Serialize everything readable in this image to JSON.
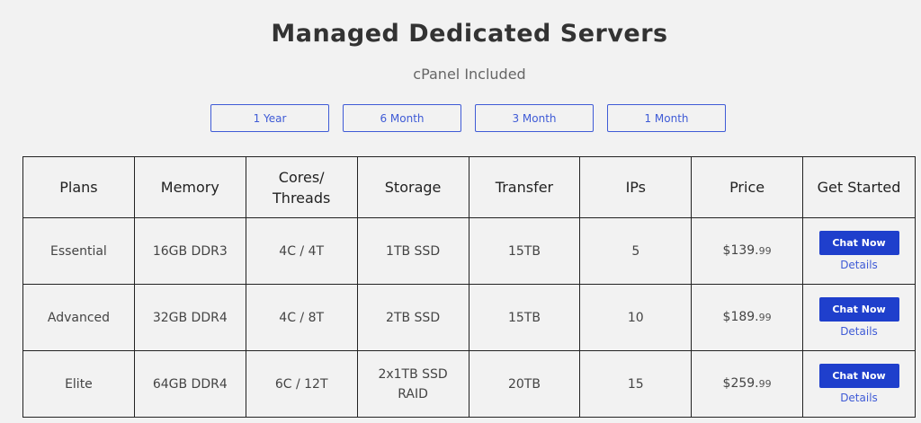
{
  "header": {
    "title": "Managed Dedicated Servers",
    "subtitle": "cPanel Included"
  },
  "terms": [
    "1 Year",
    "6 Month",
    "3 Month",
    "1 Month"
  ],
  "table": {
    "columns": [
      "Plans",
      "Memory",
      "Cores/ Threads",
      "Storage",
      "Transfer",
      "IPs",
      "Price",
      "Get Started"
    ],
    "rows": [
      {
        "plan": "Essential",
        "memory": "16GB DDR3",
        "cores": "4C / 4T",
        "storage": "1TB SSD",
        "transfer": "15TB",
        "ips": "5",
        "price_main": "$139.",
        "price_cents": "99",
        "cta": "Chat Now",
        "details": "Details"
      },
      {
        "plan": "Advanced",
        "memory": "32GB DDR4",
        "cores": "4C / 8T",
        "storage": "2TB SSD",
        "transfer": "15TB",
        "ips": "10",
        "price_main": "$189.",
        "price_cents": "99",
        "cta": "Chat Now",
        "details": "Details"
      },
      {
        "plan": "Elite",
        "memory": "64GB DDR4",
        "cores": "6C / 12T",
        "storage": "2x1TB SSD RAID",
        "transfer": "20TB",
        "ips": "15",
        "price_main": "$259.",
        "price_cents": "99",
        "cta": "Chat Now",
        "details": "Details"
      }
    ]
  },
  "colors": {
    "accent": "#3f5bd6",
    "button": "#1f3fcc",
    "background": "#f2f2f2"
  }
}
